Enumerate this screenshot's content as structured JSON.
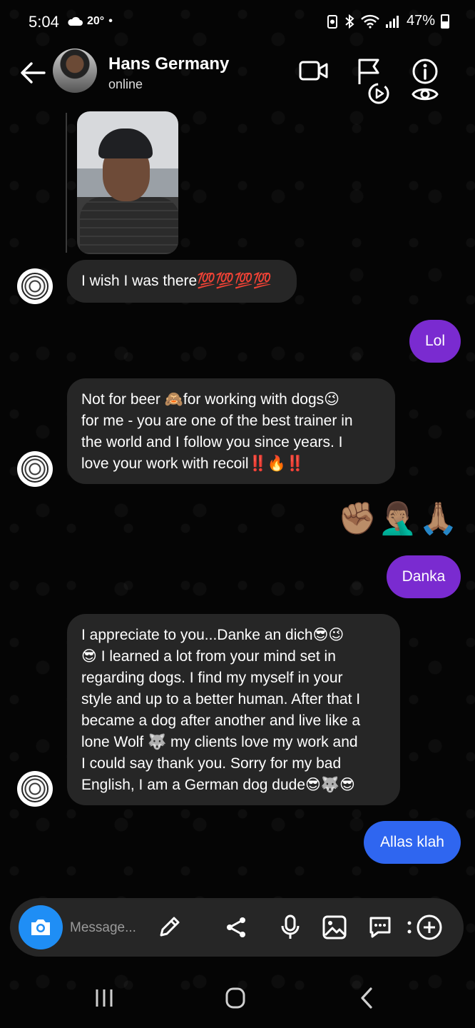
{
  "status_bar": {
    "time": "5:04",
    "weather": "20°",
    "battery": "47%"
  },
  "header": {
    "contact_name": "Hans Germany",
    "contact_status": "online"
  },
  "messages": {
    "m1": "I wish I was there💯💯💯💯",
    "m2": "Lol",
    "m3_line1": "Not for beer 🙈for working with dogs😉",
    "m3_line2": "for me - you are one of the best trainer in",
    "m3_line3": "the world and I follow you since years. I",
    "m3_line4": "love your work with recoil‼️🔥‼️",
    "m4_emojis": "✊🏽🤦🏽‍♂️🙏🏽",
    "m5": "Danka",
    "m6_line1": "I appreciate to you...Danke an dich😎😉",
    "m6_line2": "😎 I learned a lot from your mind set in",
    "m6_line3": "regarding dogs. I find my myself in your",
    "m6_line4": "style and up to a better human. After that I",
    "m6_line5": "became a dog after another and live like a",
    "m6_line6": "lone Wolf 🐺 my clients love my work and",
    "m6_line7": "I could say thank you. Sorry for my bad",
    "m6_line8": "English, I am a German dog dude😎🐺😎",
    "m7": "Allas klah"
  },
  "composer": {
    "placeholder": "Message..."
  },
  "colors": {
    "sent_purple": "#7a2bd0",
    "sent_blue": "#2f66f0",
    "received_bubble": "#262626",
    "camera_button": "#1f8ef5"
  }
}
